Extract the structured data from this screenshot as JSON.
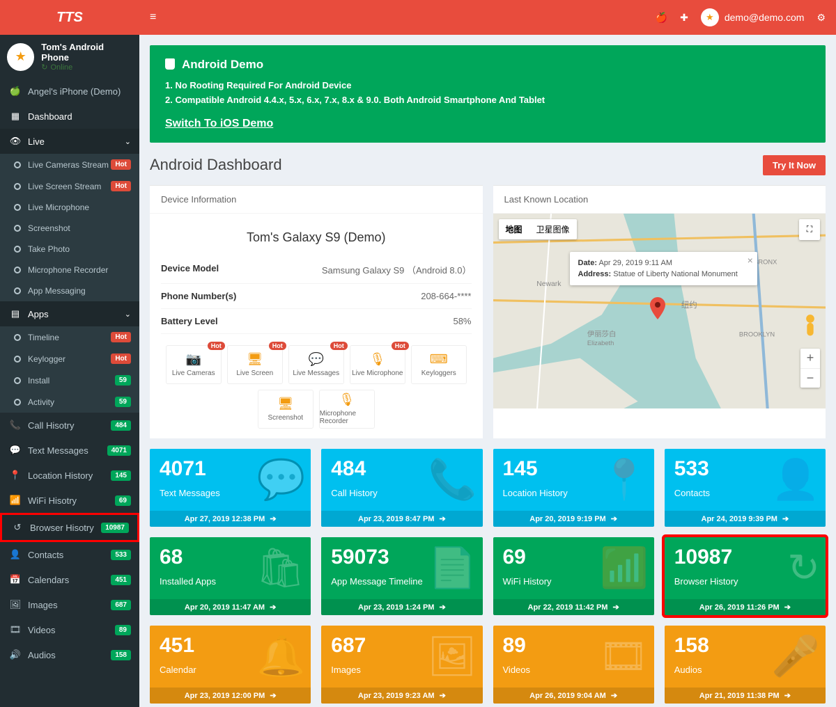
{
  "brand": "TTS",
  "user": {
    "name": "Tom's Android Phone",
    "status": "Online"
  },
  "demo_device": "Angel's iPhone (Demo)",
  "nav": {
    "dashboard": "Dashboard",
    "live": {
      "label": "Live",
      "items": [
        {
          "label": "Live Cameras Stream",
          "badge": "Hot",
          "badge_cls": "hot",
          "c": "c-grn"
        },
        {
          "label": "Live Screen Stream",
          "badge": "Hot",
          "badge_cls": "hot",
          "c": "c-red"
        },
        {
          "label": "Live Microphone",
          "c": "c-cyan"
        },
        {
          "label": "Screenshot",
          "c": "c-yel"
        },
        {
          "label": "Take Photo",
          "c": "c-cyan"
        },
        {
          "label": "Microphone Recorder",
          "c": "c-cyan"
        },
        {
          "label": "App Messaging",
          "c": "c-red"
        }
      ]
    },
    "apps": {
      "label": "Apps",
      "items": [
        {
          "label": "Timeline",
          "badge": "Hot",
          "badge_cls": "hot",
          "c": "c-red"
        },
        {
          "label": "Keylogger",
          "badge": "Hot",
          "badge_cls": "hot",
          "c": "c-red"
        },
        {
          "label": "Install",
          "badge": "59",
          "badge_cls": "green",
          "c": "c-grn"
        },
        {
          "label": "Activity",
          "badge": "59",
          "badge_cls": "green",
          "c": "c-cyan"
        }
      ]
    },
    "rows": [
      {
        "icon": "📞",
        "label": "Call Hisotry",
        "badge": "484"
      },
      {
        "icon": "💬",
        "label": "Text Messages",
        "badge": "4071"
      },
      {
        "icon": "📍",
        "label": "Location History",
        "badge": "145"
      },
      {
        "icon": "📶",
        "label": "WiFi Hisotry",
        "badge": "69"
      },
      {
        "icon": "↺",
        "label": "Browser Hisotry",
        "badge": "10987",
        "sel": true
      },
      {
        "icon": "👤",
        "label": "Contacts",
        "badge": "533"
      },
      {
        "icon": "📅",
        "label": "Calendars",
        "badge": "451"
      },
      {
        "icon": "🖼",
        "label": "Images",
        "badge": "687"
      },
      {
        "icon": "🎞",
        "label": "Videos",
        "badge": "89"
      },
      {
        "icon": "🔊",
        "label": "Audios",
        "badge": "158"
      }
    ]
  },
  "topbar": {
    "email": "demo@demo.com"
  },
  "banner": {
    "title": "Android Demo",
    "line1": "1. No Rooting Required For Android Device",
    "line2": "2. Compatible Android 4.4.x, 5.x, 6.x, 7.x, 8.x & 9.0. Both Android Smartphone And Tablet",
    "switch": "Switch To iOS Demo"
  },
  "page_title": "Android Dashboard",
  "try_btn": "Try It Now",
  "device_panel": {
    "header": "Device Information",
    "name": "Tom's Galaxy S9 (Demo)",
    "rows": [
      {
        "k": "Device Model",
        "v": "Samsung Galaxy S9 （Android 8.0）"
      },
      {
        "k": "Phone Number(s)",
        "v": "208-664-****"
      },
      {
        "k": "Battery Level",
        "v": "58%"
      }
    ],
    "quick": [
      {
        "label": "Live Cameras",
        "hot": true,
        "ico": "📷"
      },
      {
        "label": "Live Screen",
        "hot": true,
        "ico": "🖥"
      },
      {
        "label": "Live Messages",
        "hot": true,
        "ico": "💬"
      },
      {
        "label": "Live Microphone",
        "hot": true,
        "ico": "🎙"
      },
      {
        "label": "Keyloggers",
        "ico": "⌨"
      },
      {
        "label": "Screenshot",
        "ico": "🖥"
      },
      {
        "label": "Microphone Recorder",
        "ico": "🎙"
      }
    ]
  },
  "location_panel": {
    "header": "Last Known Location",
    "map_btn": "地图",
    "sat_btn": "卫星图像",
    "info": {
      "date_k": "Date:",
      "date_v": "Apr 29, 2019 9:11 AM",
      "addr_k": "Address:",
      "addr_v": "Statue of Liberty National Monument"
    }
  },
  "stats": [
    {
      "num": "4071",
      "lbl": "Text Messages",
      "foot": "Apr 27, 2019 12:38 PM",
      "cls": "sc-blue",
      "ico": "💬"
    },
    {
      "num": "484",
      "lbl": "Call History",
      "foot": "Apr 23, 2019 8:47 PM",
      "cls": "sc-blue",
      "ico": "📞"
    },
    {
      "num": "145",
      "lbl": "Location History",
      "foot": "Apr 20, 2019 9:19 PM",
      "cls": "sc-blue",
      "ico": "📍"
    },
    {
      "num": "533",
      "lbl": "Contacts",
      "foot": "Apr 24, 2019 9:39 PM",
      "cls": "sc-blue",
      "ico": "👤"
    },
    {
      "num": "68",
      "lbl": "Installed Apps",
      "foot": "Apr 20, 2019 11:47 AM",
      "cls": "sc-green",
      "ico": "🛍"
    },
    {
      "num": "59073",
      "lbl": "App Message Timeline",
      "foot": "Apr 23, 2019 1:24 PM",
      "cls": "sc-green",
      "ico": "📄"
    },
    {
      "num": "69",
      "lbl": "WiFi History",
      "foot": "Apr 22, 2019 11:42 PM",
      "cls": "sc-green",
      "ico": "📶"
    },
    {
      "num": "10987",
      "lbl": "Browser History",
      "foot": "Apr 26, 2019 11:26 PM",
      "cls": "sc-green",
      "ico": "↻",
      "sel": true
    },
    {
      "num": "451",
      "lbl": "Calendar",
      "foot": "Apr 23, 2019 12:00 PM",
      "cls": "sc-orange",
      "ico": "🔔"
    },
    {
      "num": "687",
      "lbl": "Images",
      "foot": "Apr 23, 2019 9:23 AM",
      "cls": "sc-orange",
      "ico": "🖼"
    },
    {
      "num": "89",
      "lbl": "Videos",
      "foot": "Apr 26, 2019 9:04 AM",
      "cls": "sc-orange",
      "ico": "🎞"
    },
    {
      "num": "158",
      "lbl": "Audios",
      "foot": "Apr 21, 2019 11:38 PM",
      "cls": "sc-orange",
      "ico": "🎤"
    }
  ]
}
